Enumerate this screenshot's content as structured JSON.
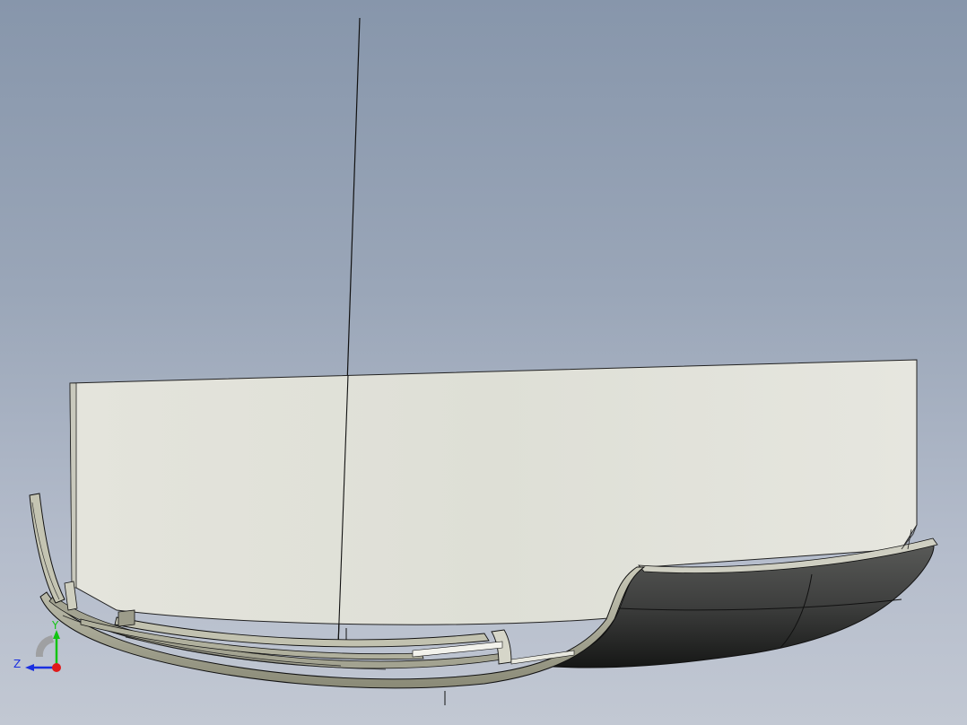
{
  "viewport": {
    "background_top": "#8796ab",
    "background_bottom": "#c2c8d3"
  },
  "model": {
    "panel_color": "#e2e2da",
    "hull_dark": "#4a4b4a",
    "frame_color": "#b9b9a6",
    "edge_color": "#111111"
  },
  "triad": {
    "x_label": "",
    "y_label": "Y",
    "z_label": "Z",
    "y_color": "#12c412",
    "z_color": "#1a2fe0",
    "x_color": "#e01a1a"
  }
}
